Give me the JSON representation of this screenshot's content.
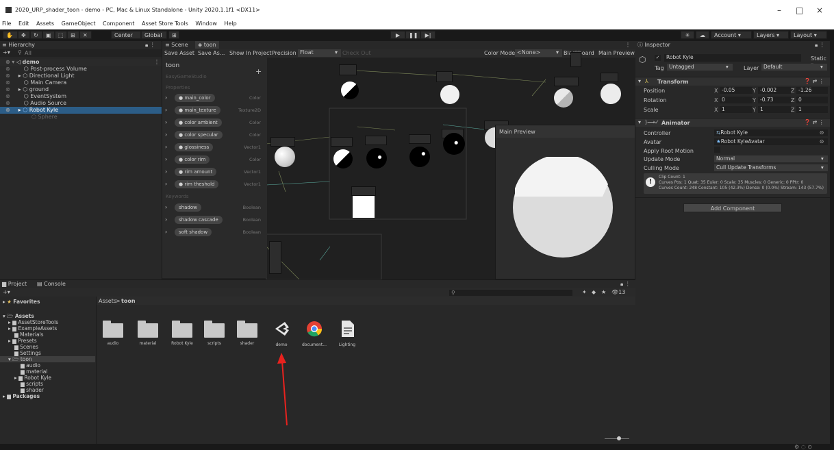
{
  "window": {
    "title": "2020_URP_shader_toon - demo - PC, Mac & Linux Standalone - Unity 2020.1.1f1 <DX11>",
    "minimize": "–",
    "maximize": "□",
    "close": "×"
  },
  "menu": [
    "File",
    "Edit",
    "Assets",
    "GameObject",
    "Component",
    "Asset Store Tools",
    "Window",
    "Help"
  ],
  "toolbar": {
    "center": "Center",
    "global": "Global",
    "account": "Account",
    "layers": "Layers",
    "layout": "Layout"
  },
  "hierarchy": {
    "tab": "Hierarchy",
    "search": "All",
    "items": [
      {
        "label": "demo"
      },
      {
        "label": "Post-process Volume"
      },
      {
        "label": "Directional Light"
      },
      {
        "label": "Main Camera"
      },
      {
        "label": "ground"
      },
      {
        "label": "EventSystem"
      },
      {
        "label": "Audio Source"
      },
      {
        "label": "Robot Kyle"
      },
      {
        "label": "Sphere"
      }
    ]
  },
  "editor": {
    "tabs": [
      "Scene",
      "toon"
    ],
    "save_asset": "Save Asset",
    "save_as": "Save As...",
    "show_in_project": "Show In Project",
    "precision_label": "Precision",
    "precision_value": "Float",
    "check_out": "Check Out",
    "color_mode_label": "Color Mode",
    "color_mode_value": "<None>",
    "blackboard": "Blackboard",
    "main_preview": "Main Preview",
    "preview_title": "Main Preview"
  },
  "blackboard": {
    "title": "toon",
    "subtitle": "EasyGameStudio",
    "properties_header": "Properties",
    "keywords_header": "Keywords",
    "properties": [
      {
        "name": "main_color",
        "type": "Color"
      },
      {
        "name": "main_texture",
        "type": "Texture2D"
      },
      {
        "name": "color ambient",
        "type": "Color"
      },
      {
        "name": "color specular",
        "type": "Color"
      },
      {
        "name": "glossiness",
        "type": "Vector1"
      },
      {
        "name": "color rim",
        "type": "Color"
      },
      {
        "name": "rim amount",
        "type": "Vector1"
      },
      {
        "name": "rim theshold",
        "type": "Vector1"
      }
    ],
    "keywords": [
      {
        "name": "shadow",
        "type": "Boolean"
      },
      {
        "name": "shadow cascade",
        "type": "Boolean"
      },
      {
        "name": "soft shadow",
        "type": "Boolean"
      }
    ]
  },
  "inspector": {
    "tab": "Inspector",
    "object_name": "Robot Kyle",
    "static": "Static",
    "tag_label": "Tag",
    "tag_value": "Untagged",
    "layer_label": "Layer",
    "layer_value": "Default",
    "transform": {
      "title": "Transform",
      "position_label": "Position",
      "rotation_label": "Rotation",
      "scale_label": "Scale",
      "position": {
        "x": "-0.05",
        "y": "-0.002",
        "z": "-1.26"
      },
      "rotation": {
        "x": "0",
        "y": "-0.73",
        "z": "0"
      },
      "scale": {
        "x": "1",
        "y": "1",
        "z": "1"
      }
    },
    "animator": {
      "title": "Animator",
      "controller_label": "Controller",
      "controller_value": "Robot Kyle",
      "avatar_label": "Avatar",
      "avatar_value": "Robot KyleAvatar",
      "apply_root_motion_label": "Apply Root Motion",
      "update_mode_label": "Update Mode",
      "update_mode_value": "Normal",
      "culling_mode_label": "Culling Mode",
      "culling_mode_value": "Cull Update Transforms",
      "info_line1": "Clip Count: 1",
      "info_line2": "Curves Pos: 1 Quat: 35 Euler: 0 Scale: 35 Muscles: 0 Generic: 0 PPtr: 0",
      "info_line3": "Curves Count: 248 Constant: 105 (42.3%) Dense: 0 (0.0%) Stream: 143 (57.7%)"
    },
    "add_component": "Add Component"
  },
  "project": {
    "tab_project": "Project",
    "tab_console": "Console",
    "breadcrumb_root": "Assets",
    "breadcrumb_sep": ">",
    "breadcrumb_current": "toon",
    "hidden_count": "13",
    "favorites": "Favorites",
    "tree": [
      {
        "label": "Assets"
      },
      {
        "label": "AssetStoreTools"
      },
      {
        "label": "ExampleAssets"
      },
      {
        "label": "Materials"
      },
      {
        "label": "Presets"
      },
      {
        "label": "Scenes"
      },
      {
        "label": "Settings"
      },
      {
        "label": "toon"
      },
      {
        "label": "audio"
      },
      {
        "label": "material"
      },
      {
        "label": "Robot Kyle"
      },
      {
        "label": "scripts"
      },
      {
        "label": "shader"
      },
      {
        "label": "Packages"
      }
    ],
    "assets": [
      {
        "label": "audio"
      },
      {
        "label": "material"
      },
      {
        "label": "Robot Kyle"
      },
      {
        "label": "scripts"
      },
      {
        "label": "shader"
      },
      {
        "label": "demo"
      },
      {
        "label": "document..."
      },
      {
        "label": "Lighting"
      }
    ]
  },
  "colors": {
    "selection": "#2c5d87",
    "annotation_arrow": "#e8221e",
    "panel": "#282828",
    "background": "#191919"
  }
}
